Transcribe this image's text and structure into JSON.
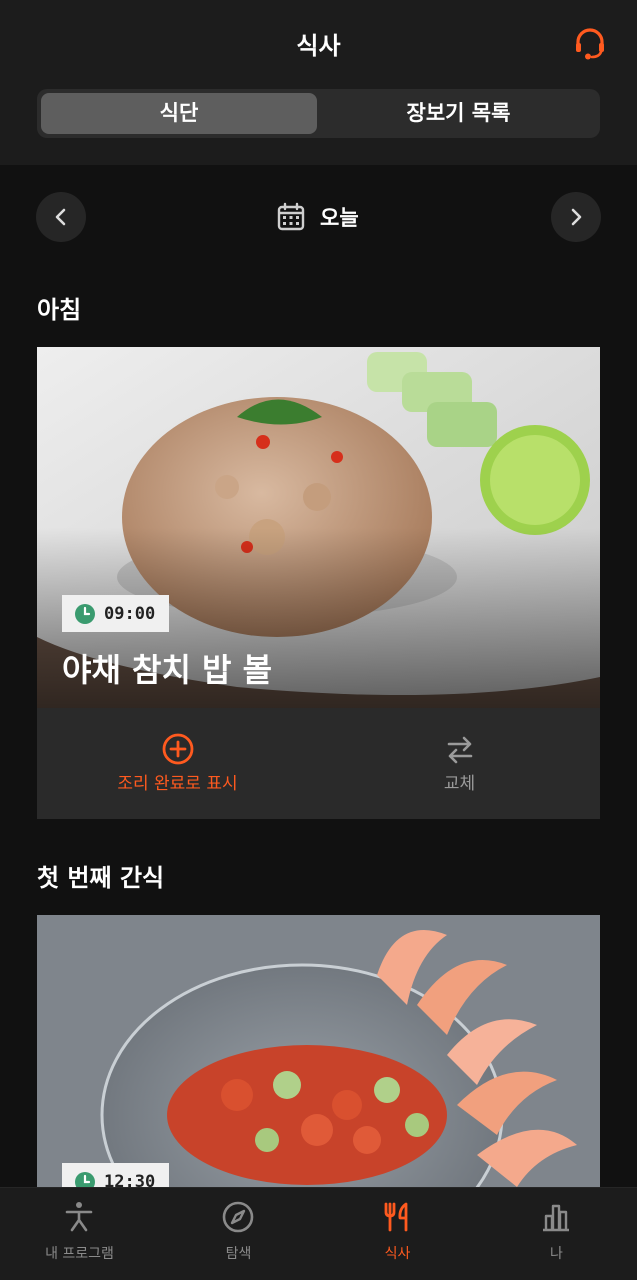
{
  "header": {
    "title": "식사",
    "tabs": [
      {
        "label": "식단",
        "active": true
      },
      {
        "label": "장보기 목록",
        "active": false
      }
    ]
  },
  "date_nav": {
    "label": "오늘"
  },
  "meals": [
    {
      "section": "아침",
      "time": "09:00",
      "name": "야채 참치 밥 볼",
      "complete_label": "조리 완료로 표시",
      "swap_label": "교체"
    },
    {
      "section": "첫 번째 간식",
      "time": "12:30"
    }
  ],
  "tabbar": {
    "items": [
      {
        "label": "내 프로그램",
        "icon": "workout-figure-icon",
        "active": false
      },
      {
        "label": "탐색",
        "icon": "compass-icon",
        "active": false
      },
      {
        "label": "식사",
        "icon": "fork-knife-icon",
        "active": true
      },
      {
        "label": "나",
        "icon": "stats-icon",
        "active": false
      }
    ]
  },
  "colors": {
    "accent": "#ff5a1f",
    "background": "#111111",
    "header": "#1c1c1c",
    "card_action_bar": "#2a2a2a",
    "clock_green": "#3a9b6f"
  }
}
